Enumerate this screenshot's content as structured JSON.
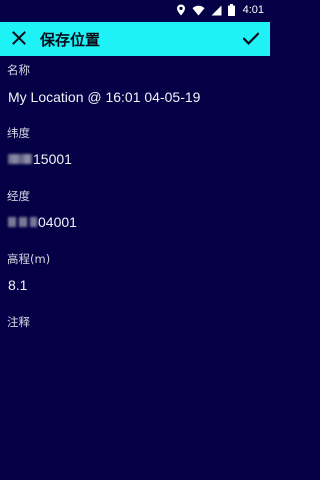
{
  "status_bar": {
    "time": "4:01",
    "icons": [
      "location-icon",
      "wifi-icon",
      "signal-icon",
      "battery-icon"
    ]
  },
  "app_bar": {
    "title": "保存位置",
    "close_icon": "close-icon",
    "confirm_icon": "check-icon",
    "background": "#1ff2f7"
  },
  "form": {
    "name": {
      "label": "名称",
      "value": "My Location @ 16:01 04-05-19"
    },
    "latitude": {
      "label": "纬度",
      "value_visible": "15001"
    },
    "longitude": {
      "label": "经度",
      "value_visible": "04001"
    },
    "altitude": {
      "label": "高程(m)",
      "value": "8.1"
    },
    "notes": {
      "label": "注释",
      "value": ""
    }
  },
  "colors": {
    "background": "#030045",
    "accent": "#1ff2f7",
    "text": "#f2f2f8"
  }
}
